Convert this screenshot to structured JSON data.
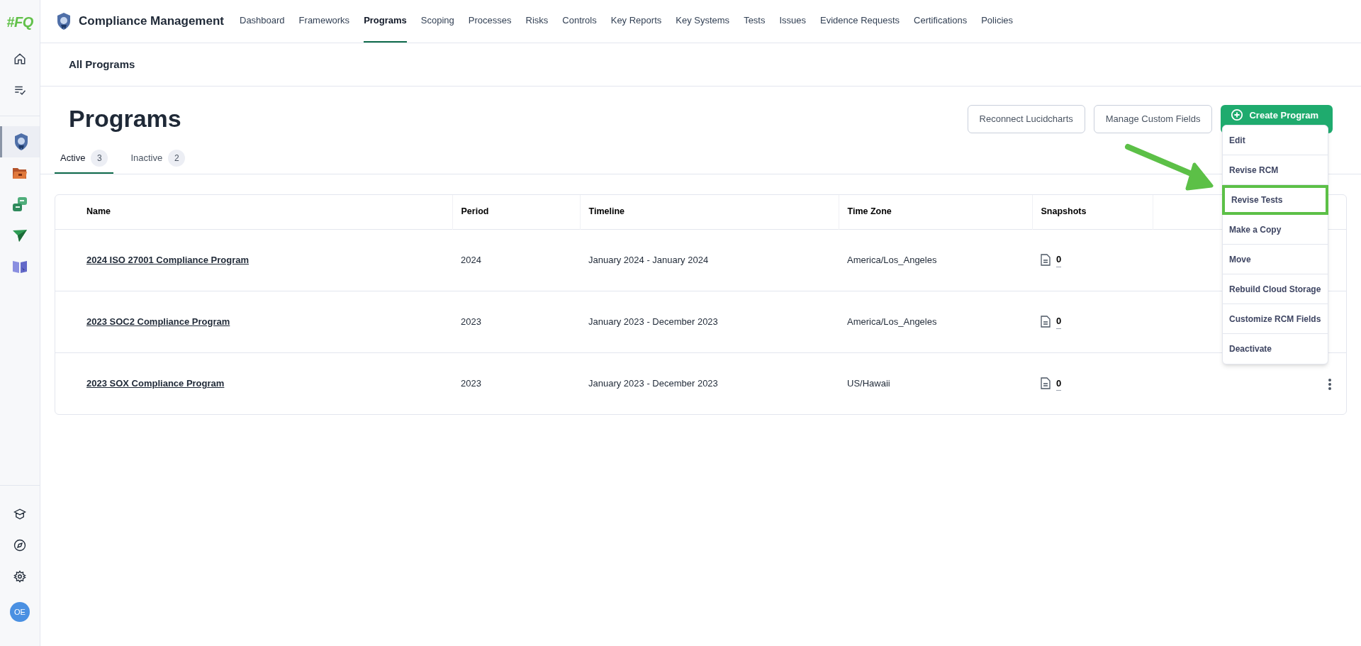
{
  "sidebar": {
    "logo": "#FQ",
    "items": [
      {
        "selected": false
      },
      {
        "selected": false
      },
      {
        "selected": true
      },
      {
        "selected": false
      },
      {
        "selected": false
      },
      {
        "selected": false
      },
      {
        "selected": false
      }
    ],
    "avatar": "OE"
  },
  "app_title": "Compliance Management",
  "nav": [
    {
      "label": "Dashboard",
      "selected": false
    },
    {
      "label": "Frameworks",
      "selected": false
    },
    {
      "label": "Programs",
      "selected": true
    },
    {
      "label": "Scoping",
      "selected": false
    },
    {
      "label": "Processes",
      "selected": false
    },
    {
      "label": "Risks",
      "selected": false
    },
    {
      "label": "Controls",
      "selected": false
    },
    {
      "label": "Key Reports",
      "selected": false
    },
    {
      "label": "Key Systems",
      "selected": false
    },
    {
      "label": "Tests",
      "selected": false
    },
    {
      "label": "Issues",
      "selected": false
    },
    {
      "label": "Evidence Requests",
      "selected": false
    },
    {
      "label": "Certifications",
      "selected": false
    },
    {
      "label": "Policies",
      "selected": false
    }
  ],
  "breadcrumb": "All Programs",
  "page_title": "Programs",
  "buttons": [
    {
      "label": "Reconnect Lucidcharts",
      "kind": "outline"
    },
    {
      "label": "Manage Custom Fields",
      "kind": "outline"
    },
    {
      "label": "Create Program",
      "kind": "primary"
    }
  ],
  "tabs": [
    {
      "label": "Active",
      "count": "3",
      "selected": true
    },
    {
      "label": "Inactive",
      "count": "2",
      "selected": false
    }
  ],
  "table": {
    "columns": [
      "Name",
      "Period",
      "Timeline",
      "Time Zone",
      "Snapshots"
    ],
    "rows": [
      {
        "name": "2024 ISO 27001 Compliance Program",
        "period": "2024",
        "timeline": "January 2024 - January 2024",
        "time_zone": "America/Los_Angeles",
        "snapshots": "0",
        "menu_visible": false
      },
      {
        "name": "2023 SOC2 Compliance Program",
        "period": "2023",
        "timeline": "January 2023 - December 2023",
        "time_zone": "America/Los_Angeles",
        "snapshots": "0",
        "menu_visible": false
      },
      {
        "name": "2023 SOX Compliance Program",
        "period": "2023",
        "timeline": "January 2023 - December 2023",
        "time_zone": "US/Hawaii",
        "snapshots": "0",
        "menu_visible": true
      }
    ]
  },
  "context_menu": [
    {
      "label": "Edit",
      "highlighted": false
    },
    {
      "label": "Revise RCM",
      "highlighted": false
    },
    {
      "label": "Revise Tests",
      "highlighted": true
    },
    {
      "label": "Make a Copy",
      "highlighted": false
    },
    {
      "label": "Move",
      "highlighted": false
    },
    {
      "label": "Rebuild Cloud Storage",
      "highlighted": false
    },
    {
      "label": "Customize RCM Fields",
      "highlighted": false
    },
    {
      "label": "Deactivate",
      "highlighted": false
    }
  ]
}
